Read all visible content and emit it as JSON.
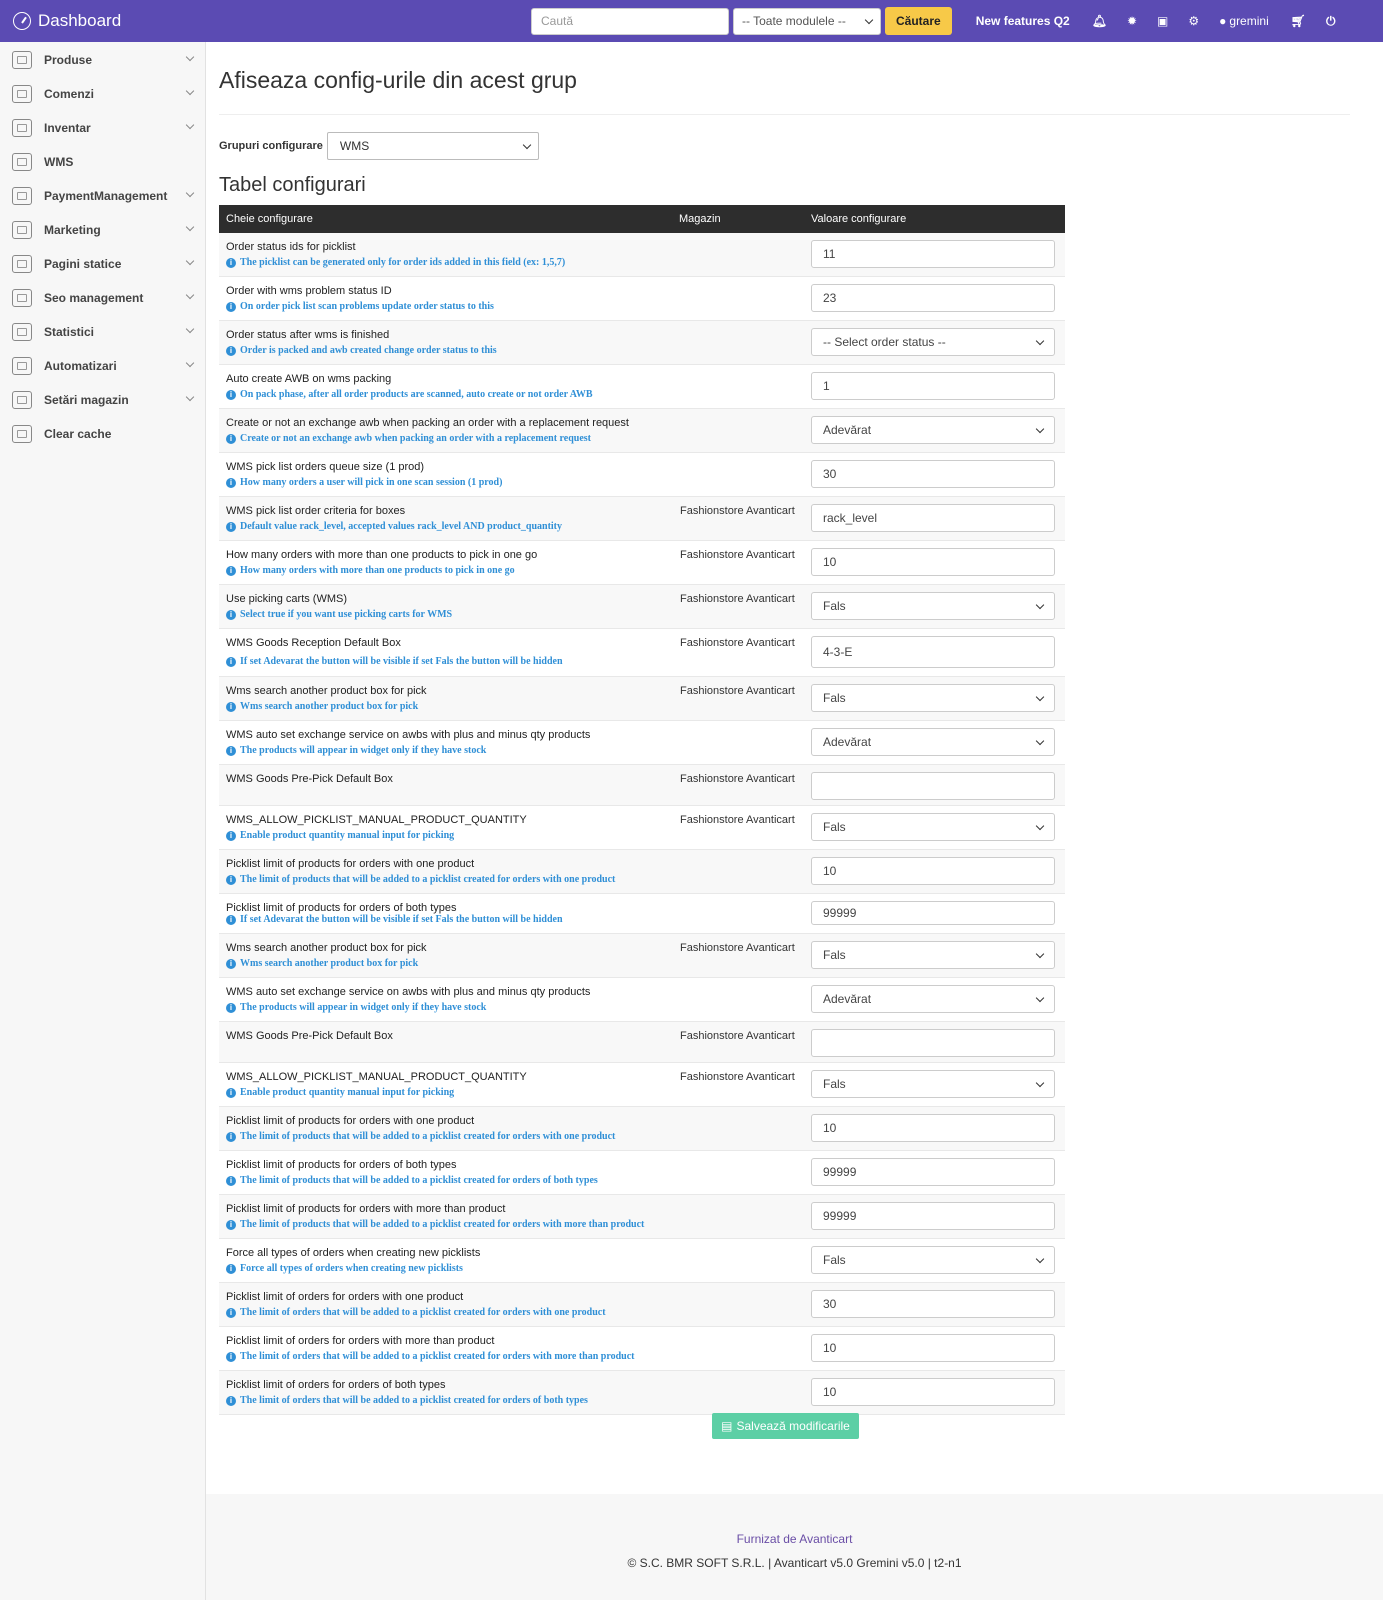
{
  "topbar": {
    "title": "Dashboard",
    "search_placeholder": "Caută",
    "modules_select": "-- Toate modulele --",
    "search_button": "Căutare",
    "new_features": "New features Q2",
    "user": "gremini"
  },
  "sidebar": {
    "items": [
      {
        "label": "Produse",
        "icon": "shop-icon",
        "chevron": true
      },
      {
        "label": "Comenzi",
        "icon": "cart-icon",
        "chevron": true
      },
      {
        "label": "Inventar",
        "icon": "boxes-icon",
        "chevron": true
      },
      {
        "label": "WMS",
        "icon": "warehouse-icon",
        "chevron": false
      },
      {
        "label": "PaymentManagement",
        "icon": "payment-icon",
        "chevron": true
      },
      {
        "label": "Marketing",
        "icon": "marketing-icon",
        "chevron": true
      },
      {
        "label": "Pagini statice",
        "icon": "page-icon",
        "chevron": true
      },
      {
        "label": "Seo management",
        "icon": "seo-icon",
        "chevron": true
      },
      {
        "label": "Statistici",
        "icon": "stats-icon",
        "chevron": true
      },
      {
        "label": "Automatizari",
        "icon": "magic-icon",
        "chevron": true
      },
      {
        "label": "Setări magazin",
        "icon": "settings-icon",
        "chevron": true
      },
      {
        "label": "Clear cache",
        "icon": "cache-icon",
        "chevron": false
      }
    ]
  },
  "page": {
    "title": "Afiseaza config-urile din acest grup",
    "group_label": "Grupuri configurare",
    "group_value": "WMS",
    "table_title": "Tabel configurari",
    "col_key": "Cheie configurare",
    "col_store": "Magazin",
    "col_value": "Valoare configurare",
    "save_button": "Salvează modificarile"
  },
  "rows": [
    {
      "key": "Order status ids for picklist",
      "hint": "The picklist can be generated only for order ids added in this field (ex: 1,5,7)",
      "store": "",
      "value": "11",
      "type": "input"
    },
    {
      "key": "Order with wms problem status ID",
      "hint": "On order pick list scan problems update order status to this",
      "store": "",
      "value": "23",
      "type": "input"
    },
    {
      "key": "Order status after wms is finished",
      "hint": "Order is packed and awb created change order status to this",
      "store": "",
      "value": "-- Select order status --",
      "type": "select"
    },
    {
      "key": "Auto create AWB on wms packing",
      "hint": "On pack phase, after all order products are scanned, auto create or not order AWB",
      "store": "",
      "value": "1",
      "type": "input"
    },
    {
      "key": "Create or not an exchange awb when packing an order with a replacement request",
      "hint": "Create or not an exchange awb when packing an order with a replacement request",
      "store": "",
      "value": "Adevărat",
      "type": "select"
    },
    {
      "key": "WMS pick list orders queue size (1 prod)",
      "hint": "How many orders a user will pick in one scan session (1 prod)",
      "store": "",
      "value": "30",
      "type": "input"
    },
    {
      "key": "WMS pick list order criteria for boxes",
      "hint": "Default value rack_level, accepted values rack_level AND product_quantity",
      "store": "Fashionstore Avanticart",
      "value": "rack_level",
      "type": "input"
    },
    {
      "key": "How many orders with more than one products to pick in one go",
      "hint": "How many orders with more than one products to pick in one go",
      "store": "Fashionstore Avanticart",
      "value": "10",
      "type": "input"
    },
    {
      "key": "Use picking carts (WMS)",
      "hint": "Select true if you want use picking carts for WMS",
      "store": "Fashionstore Avanticart",
      "value": "Fals",
      "type": "select"
    },
    {
      "key": "WMS Goods Reception Default Box",
      "hint": "If set Adevarat the button will be visible if set Fals the button will be hidden",
      "store": "Fashionstore Avanticart",
      "value": "4-3-E",
      "type": "input",
      "tall": true
    },
    {
      "key": "Wms search another product box for pick",
      "hint": "Wms search another product box for pick",
      "store": "Fashionstore Avanticart",
      "value": "Fals",
      "type": "select"
    },
    {
      "key": "WMS auto set exchange service on awbs with plus and minus qty products",
      "hint": "The products will appear in widget only if they have stock",
      "store": "",
      "value": "Adevărat",
      "type": "select"
    },
    {
      "key": "WMS Goods Pre-Pick Default Box",
      "hint": "",
      "store": "Fashionstore Avanticart",
      "value": "",
      "type": "input",
      "h": 41
    },
    {
      "key": "WMS_ALLOW_PICKLIST_MANUAL_PRODUCT_QUANTITY",
      "hint": "Enable product quantity manual input for picking",
      "store": "Fashionstore Avanticart",
      "value": "Fals",
      "type": "select"
    },
    {
      "key": "Picklist limit of products for orders with one product",
      "hint": "The limit of products that will be added to a picklist created for orders with one product",
      "store": "",
      "value": "10",
      "type": "input"
    },
    {
      "key": "Picklist limit of products for orders of both types",
      "hint": "If set Adevarat the button will be visible if set Fals the button will be hidden",
      "store": "",
      "value": "99999",
      "type": "input",
      "h": 40,
      "short": true
    },
    {
      "key": "Wms search another product box for pick",
      "hint": "Wms search another product box for pick",
      "store": "Fashionstore Avanticart",
      "value": "Fals",
      "type": "select"
    },
    {
      "key": "WMS auto set exchange service on awbs with plus and minus qty products",
      "hint": "The products will appear in widget only if they have stock",
      "store": "",
      "value": "Adevărat",
      "type": "select"
    },
    {
      "key": "WMS Goods Pre-Pick Default Box",
      "hint": "",
      "store": "Fashionstore Avanticart",
      "value": "",
      "type": "input",
      "h": 41
    },
    {
      "key": "WMS_ALLOW_PICKLIST_MANUAL_PRODUCT_QUANTITY",
      "hint": "Enable product quantity manual input for picking",
      "store": "Fashionstore Avanticart",
      "value": "Fals",
      "type": "select"
    },
    {
      "key": "Picklist limit of products for orders with one product",
      "hint": "The limit of products that will be added to a picklist created for orders with one product",
      "store": "",
      "value": "10",
      "type": "input"
    },
    {
      "key": "Picklist limit of products for orders of both types",
      "hint": "The limit of products that will be added to a picklist created for orders of both types",
      "store": "",
      "value": "99999",
      "type": "input"
    },
    {
      "key": "Picklist limit of products for orders with more than product",
      "hint": "The limit of products that will be added to a picklist created for orders with more than product",
      "store": "",
      "value": "99999",
      "type": "input"
    },
    {
      "key": "Force all types of orders when creating new picklists",
      "hint": "Force all types of orders when creating new picklists",
      "store": "",
      "value": "Fals",
      "type": "select"
    },
    {
      "key": "Picklist limit of orders for orders with one product",
      "hint": "The limit of orders that will be added to a picklist created for orders with one product",
      "store": "",
      "value": "30",
      "type": "input"
    },
    {
      "key": "Picklist limit of orders for orders with more than product",
      "hint": "The limit of orders that will be added to a picklist created for orders with more than product",
      "store": "",
      "value": "10",
      "type": "input"
    },
    {
      "key": "Picklist limit of orders for orders of both types",
      "hint": "The limit of orders that will be added to a picklist created for orders of both types",
      "store": "",
      "value": "10",
      "type": "input"
    }
  ],
  "footer": {
    "provided_by": "Furnizat de Avanticart",
    "copyright": "© S.C. BMR SOFT S.R.L. | Avanticart v5.0 Gremini v5.0 | t2-n1"
  },
  "colors": {
    "topbar": "#5b4bb3",
    "search_button": "#f7c948",
    "hint": "#2f8fd6",
    "save_button": "#5ccfa5"
  }
}
